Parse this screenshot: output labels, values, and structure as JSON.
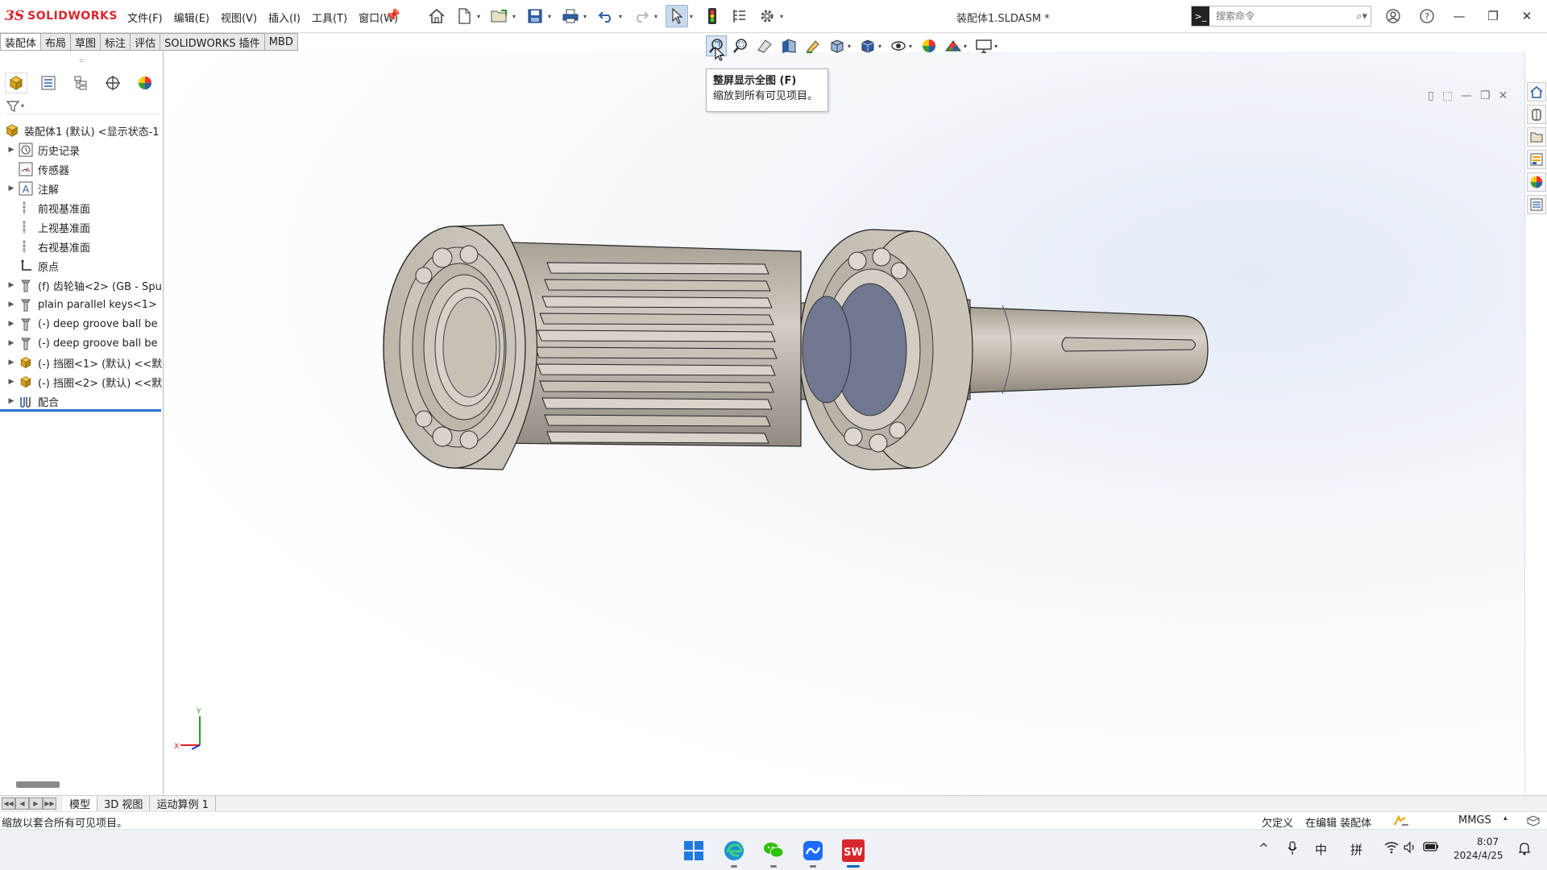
{
  "app": {
    "brand": "SOLIDWORKS",
    "document_title": "装配体1.SLDASM *"
  },
  "menu": [
    "文件(F)",
    "编辑(E)",
    "视图(V)",
    "插入(I)",
    "工具(T)",
    "窗口(W)"
  ],
  "quick_tools": [
    "home-icon",
    "new-document-icon",
    "open-icon",
    "save-icon",
    "print-icon",
    "undo-icon",
    "redo-icon",
    "select-icon",
    "rebuild-icon",
    "file-properties-icon",
    "options-icon"
  ],
  "search": {
    "placeholder": "搜索命令"
  },
  "command_tabs": [
    "装配体",
    "布局",
    "草图",
    "标注",
    "评估",
    "SOLIDWORKS 插件",
    "MBD"
  ],
  "heads_up_toolbar": [
    "zoom-to-fit-icon",
    "zoom-to-area-icon",
    "previous-view-icon",
    "section-view-icon",
    "dynamic-annotation-icon",
    "view-orientation-icon",
    "display-style-icon",
    "hide-show-icon",
    "edit-appearance-icon",
    "apply-scene-icon",
    "view-settings-icon"
  ],
  "tooltip": {
    "title": "整屏显示全图  (F)",
    "description": "缩放到所有可见项目。"
  },
  "tree": {
    "root": "装配体1 (默认) <显示状态-1",
    "items": [
      {
        "label": "历史记录",
        "expand": true,
        "icon": "history-icon"
      },
      {
        "label": "传感器",
        "expand": false,
        "icon": "sensor-icon"
      },
      {
        "label": "注解",
        "expand": true,
        "icon": "annotation-icon"
      },
      {
        "label": "前视基准面",
        "expand": false,
        "icon": "plane-icon"
      },
      {
        "label": "上视基准面",
        "expand": false,
        "icon": "plane-icon"
      },
      {
        "label": "右视基准面",
        "expand": false,
        "icon": "plane-icon"
      },
      {
        "label": "原点",
        "expand": false,
        "icon": "origin-icon"
      },
      {
        "label": "(f) 齿轮轴<2> (GB - Spu",
        "expand": true,
        "icon": "part-icon"
      },
      {
        "label": "plain parallel keys<1>",
        "expand": true,
        "icon": "part-icon"
      },
      {
        "label": "(-) deep groove ball be",
        "expand": true,
        "icon": "part-icon"
      },
      {
        "label": "(-) deep groove ball be",
        "expand": true,
        "icon": "part-icon"
      },
      {
        "label": "(-) 挡圈<1> (默认) <<默",
        "expand": true,
        "icon": "subassembly-icon"
      },
      {
        "label": "(-) 挡圈<2> (默认) <<默",
        "expand": true,
        "icon": "subassembly-icon"
      },
      {
        "label": "配合",
        "expand": true,
        "icon": "mates-icon"
      }
    ]
  },
  "bottom_tabs": [
    "模型",
    "3D 视图",
    "运动算例 1"
  ],
  "status": {
    "message": "缩放以套合所有可见项目。",
    "state": "欠定义",
    "editing": "在编辑 装配体",
    "units": "MMGS"
  },
  "taskbar": {
    "apps": [
      "start-icon",
      "edge-icon",
      "wechat-icon",
      "lark-icon",
      "solidworks-icon"
    ],
    "ime_lang": "中",
    "ime_mode": "拼",
    "time": "8:07",
    "date": "2024/4/25"
  },
  "colors": {
    "brand_red": "#d9262c",
    "part_color": "#cfc8bd",
    "retainer_blue": "#6f7890",
    "selection_blue": "#2b6fd6"
  }
}
